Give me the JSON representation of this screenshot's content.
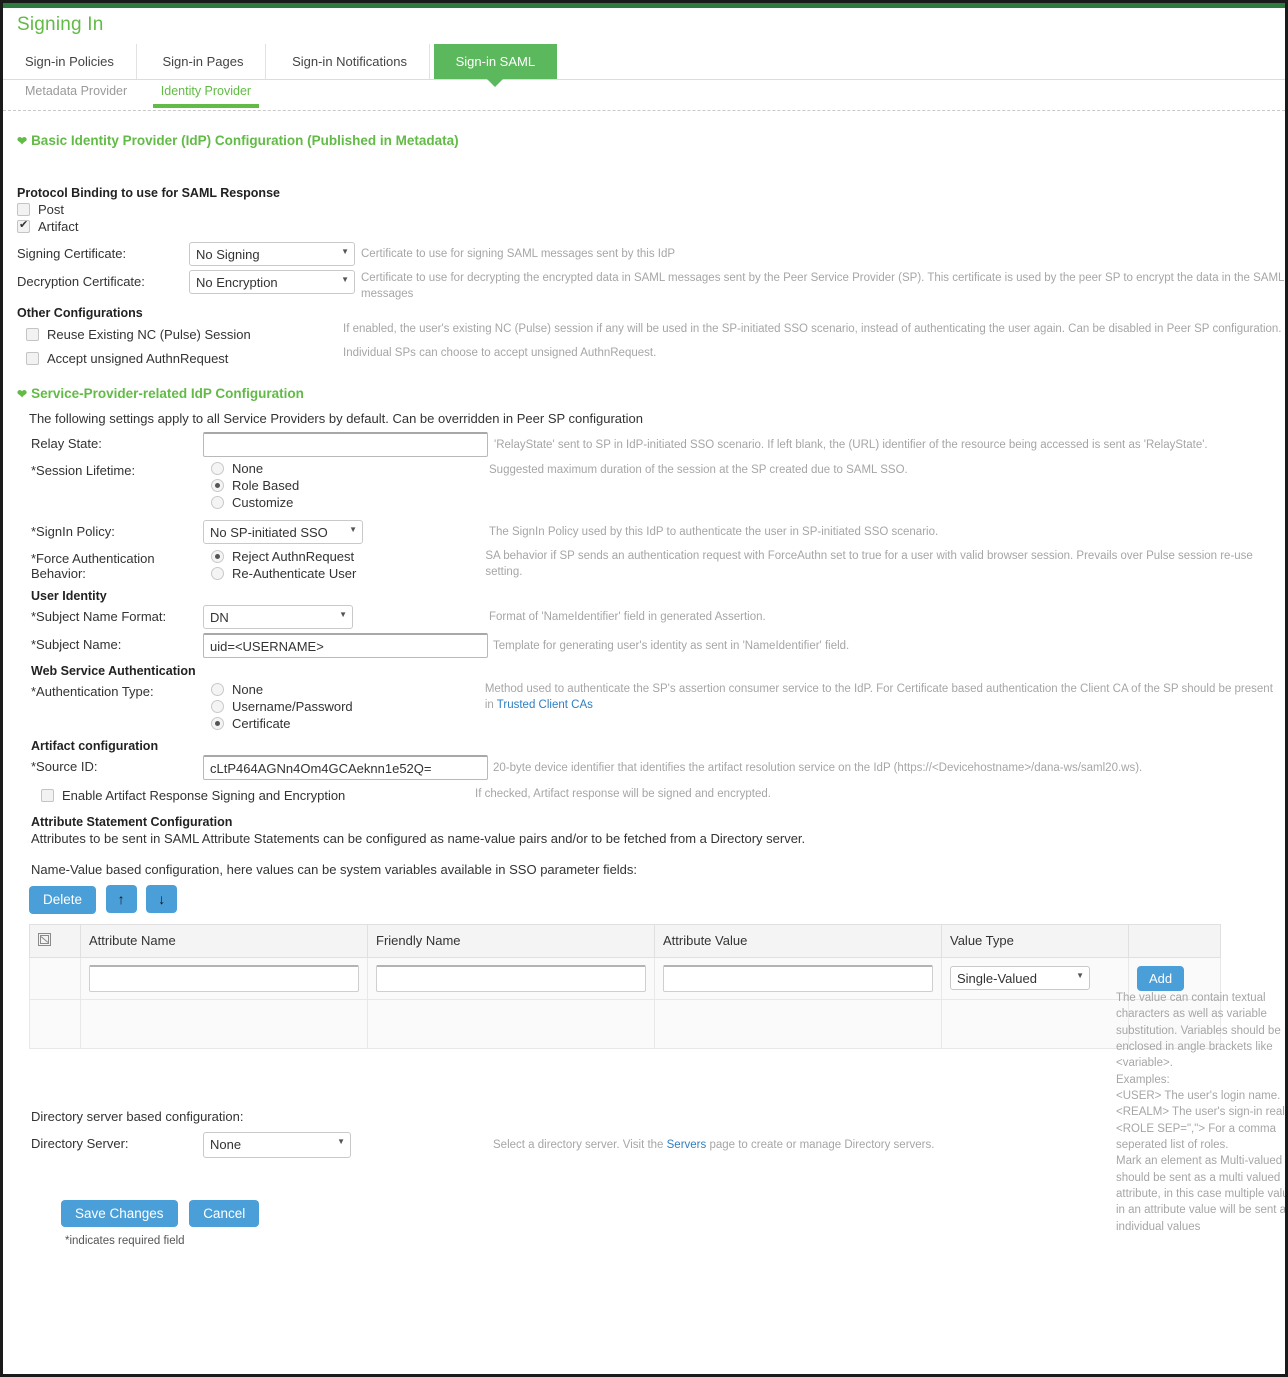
{
  "page": {
    "title": "Signing In",
    "required_note": "*indicates required field"
  },
  "tabs": [
    {
      "label": "Sign-in Policies",
      "active": false
    },
    {
      "label": "Sign-in Pages",
      "active": false
    },
    {
      "label": "Sign-in Notifications",
      "active": false
    },
    {
      "label": "Sign-in SAML",
      "active": true
    }
  ],
  "subtabs": [
    {
      "label": "Metadata Provider",
      "active": false
    },
    {
      "label": "Identity Provider",
      "active": true
    }
  ],
  "basic": {
    "section_title": "Basic Identity Provider (IdP) Configuration (Published in Metadata)",
    "protocol_binding_label": "Protocol Binding to use for SAML Response",
    "post_label": "Post",
    "post_checked": false,
    "artifact_label": "Artifact",
    "artifact_checked": true,
    "signing_cert_label": "Signing Certificate:",
    "signing_cert_value": "No Signing",
    "signing_cert_help": "Certificate to use for signing SAML messages sent by this IdP",
    "decryption_cert_label": "Decryption Certificate:",
    "decryption_cert_value": "No Encryption",
    "decryption_cert_help": "Certificate to use for decrypting the encrypted data in SAML messages sent by the Peer Service Provider (SP). This certificate is used by the peer SP to encrypt the data in the SAML messages",
    "other_config_label": "Other Configurations",
    "reuse_session_label": "Reuse Existing NC (Pulse) Session",
    "reuse_session_checked": false,
    "reuse_session_help": "If enabled, the user's existing NC (Pulse) session if any will be used in the SP-initiated SSO scenario, instead of authenticating the user again. Can be disabled in Peer SP configuration.",
    "accept_unsigned_label": "Accept unsigned AuthnRequest",
    "accept_unsigned_checked": false,
    "accept_unsigned_help": "Individual SPs can choose to accept unsigned AuthnRequest."
  },
  "sp": {
    "section_title": "Service-Provider-related IdP Configuration",
    "intro": "The following settings apply to all Service Providers by default. Can be overridden in Peer SP configuration",
    "relay_state_label": "Relay State:",
    "relay_state_value": "",
    "relay_state_placeholder": "",
    "relay_state_help": "'RelayState' sent to SP in IdP-initiated SSO scenario. If left blank, the (URL) identifier of the resource being accessed is sent as 'RelayState'.",
    "session_lifetime_label": "*Session Lifetime:",
    "session_lifetime_options": [
      {
        "label": "None",
        "selected": false
      },
      {
        "label": "Role Based",
        "selected": true
      },
      {
        "label": "Customize",
        "selected": false
      }
    ],
    "session_lifetime_help": "Suggested maximum duration of the session at the SP created due to SAML SSO.",
    "signin_policy_label": "*SignIn Policy:",
    "signin_policy_value": "No SP-initiated SSO",
    "signin_policy_help": "The SignIn Policy used by this IdP to authenticate the user in SP-initiated SSO scenario.",
    "force_auth_label_line1": "*Force Authentication",
    "force_auth_label_line2": "Behavior:",
    "force_auth_options": [
      {
        "label": "Reject AuthnRequest",
        "selected": true
      },
      {
        "label": "Re-Authenticate User",
        "selected": false
      }
    ],
    "force_auth_help": "SA behavior if SP sends an authentication request with ForceAuthn set to true for a user with valid browser session. Prevails over Pulse session re-use setting.",
    "user_identity_label": "User Identity",
    "subject_name_format_label": "*Subject Name Format:",
    "subject_name_format_value": "DN",
    "subject_name_format_help": "Format of 'NameIdentifier' field in generated Assertion.",
    "subject_name_label": "*Subject Name:",
    "subject_name_value": "uid=<USERNAME>",
    "subject_name_help": "Template for generating user's identity as sent in 'NameIdentifier' field.",
    "web_service_auth_label": "Web Service Authentication",
    "auth_type_label": "*Authentication Type:",
    "auth_type_options": [
      {
        "label": "None",
        "selected": false
      },
      {
        "label": "Username/Password",
        "selected": false
      },
      {
        "label": "Certificate",
        "selected": true
      }
    ],
    "auth_type_help_part1": "Method used to authenticate the SP's assertion consumer service to the IdP. For Certificate based authentication the Client CA of the SP should be present in ",
    "auth_type_help_link": "Trusted Client CAs",
    "artifact_config_label": "Artifact configuration",
    "source_id_label": "*Source ID:",
    "source_id_value": "cLtP464AGNn4Om4GCAeknn1e52Q=",
    "source_id_help": "20-byte device identifier that identifies the artifact resolution service on the IdP (https://<Devicehostname>/dana-ws/saml20.ws).",
    "enable_artifact_signing_label": "Enable Artifact Response Signing and Encryption",
    "enable_artifact_signing_checked": false,
    "enable_artifact_signing_help": "If checked, Artifact response will be signed and encrypted."
  },
  "attributes": {
    "section_label": "Attribute Statement Configuration",
    "description": "Attributes to be sent in SAML Attribute Statements can be configured as name-value pairs and/or to be fetched from a Directory server.",
    "namevalue_intro": "Name-Value based configuration, here values can be system variables available in SSO parameter fields:",
    "delete_label": "Delete",
    "move_up_icon": "↑",
    "move_down_icon": "↓",
    "columns": [
      "Attribute Name",
      "Friendly Name",
      "Attribute Value",
      "Value Type"
    ],
    "new_row": {
      "attribute_name": "",
      "friendly_name": "",
      "attribute_value": "",
      "value_type": "Single-Valued"
    },
    "add_label": "Add",
    "side_help": "The value can contain textual characters as well as variable substitution. Variables should be enclosed in angle brackets like <variable>.\nExamples:\n<USER> The user's login name.\n<REALM> The user's sign-in realm.\n<ROLE SEP=\",\"> For a comma seperated list of roles.\nMark an element as Multi-valued if it should be sent as a multi valued attribute, in this case multiple values in an attribute value will be sent as individual values"
  },
  "directory": {
    "intro": "Directory server based configuration:",
    "label": "Directory Server:",
    "value": "None",
    "help_part1": "Select a directory server. Visit the ",
    "help_link": "Servers",
    "help_part2": " page to create or manage Directory servers."
  },
  "footer": {
    "save_label": "Save Changes",
    "cancel_label": "Cancel"
  },
  "colors": {
    "green": "#5cb85c",
    "green_text": "#62bb46",
    "blue_button": "#4a9fd8",
    "link": "#2f7fc1"
  }
}
